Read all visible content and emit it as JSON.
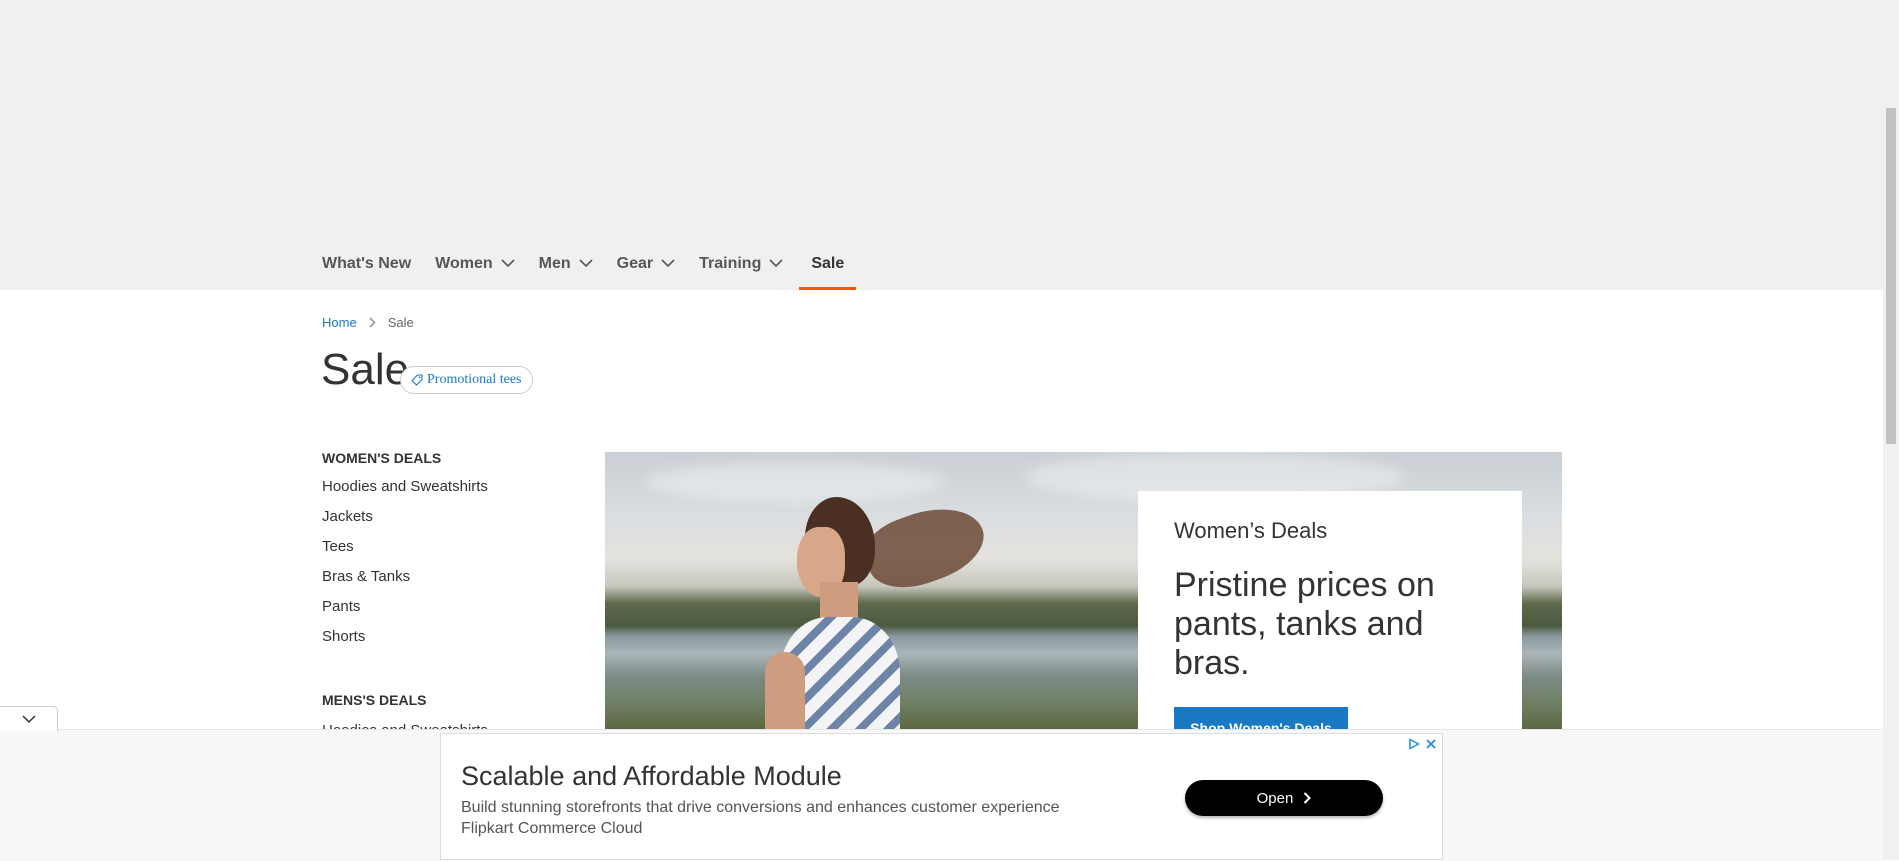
{
  "nav": {
    "items": [
      {
        "label": "What's New",
        "has_dropdown": false
      },
      {
        "label": "Women",
        "has_dropdown": true
      },
      {
        "label": "Men",
        "has_dropdown": true
      },
      {
        "label": "Gear",
        "has_dropdown": true
      },
      {
        "label": "Training",
        "has_dropdown": true
      },
      {
        "label": "Sale",
        "has_dropdown": false,
        "active": true
      }
    ],
    "active_color": "#ff5501"
  },
  "breadcrumb": {
    "home": "Home",
    "current": "Sale"
  },
  "page": {
    "title": "Sale",
    "promo_tag": "Promotional tees"
  },
  "sidebar": {
    "womens_heading": "WOMEN'S DEALS",
    "womens_items": [
      "Hoodies and Sweatshirts",
      "Jackets",
      "Tees",
      "Bras & Tanks",
      "Pants",
      "Shorts"
    ],
    "mens_heading": "MENS'S DEALS",
    "mens_first_item": "Hoodies and Sweatshirts"
  },
  "hero": {
    "subtitle": "Women’s Deals",
    "headline": "Pristine prices on pants, tanks and bras.",
    "cta": "Shop Women's Deals",
    "cta_color": "#1979c3"
  },
  "ad": {
    "title": "Scalable and Affordable Module",
    "description": "Build stunning storefronts that drive conversions and enhances customer experience",
    "advertiser": "Flipkart Commerce Cloud",
    "button": "Open"
  },
  "icons": [
    "chevron-down-icon",
    "chevron-right-icon",
    "tag-icon",
    "adchoices-icon",
    "close-icon"
  ]
}
